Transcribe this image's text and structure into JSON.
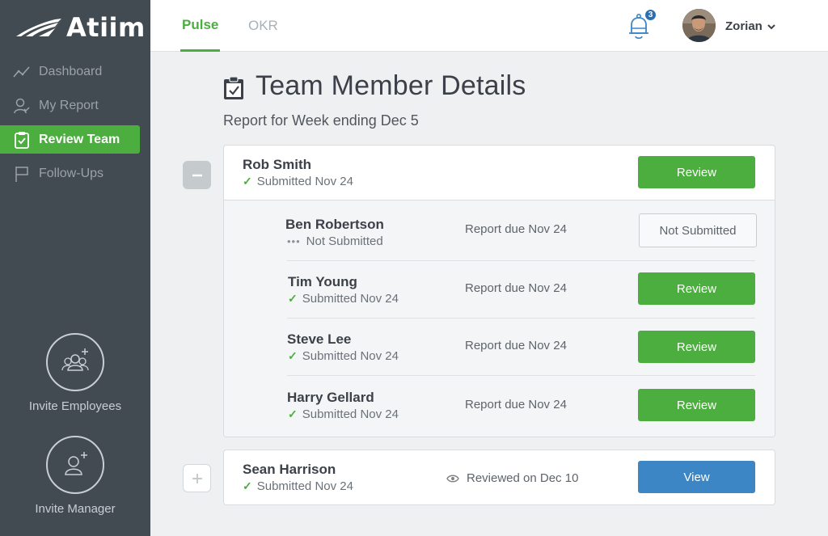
{
  "app": {
    "logo_text": "Atiim"
  },
  "sidebar": {
    "items": [
      {
        "label": "Dashboard"
      },
      {
        "label": "My Report"
      },
      {
        "label": "Review Team"
      },
      {
        "label": "Follow-Ups"
      }
    ],
    "invite_employees": "Invite Employees",
    "invite_manager": "Invite Manager"
  },
  "topbar": {
    "tabs": [
      {
        "label": "Pulse"
      },
      {
        "label": "OKR"
      }
    ],
    "notification_count": "3",
    "user_name": "Zorian"
  },
  "page": {
    "title": "Team Member Details",
    "subtitle": "Report for Week ending Dec 5"
  },
  "manager": {
    "name": "Rob Smith",
    "status": "Submitted Nov 24",
    "button": "Review"
  },
  "reports": [
    {
      "name": "Ben Robertson",
      "status": "Not Submitted",
      "due": "Report due Nov 24",
      "button": "Not Submitted"
    },
    {
      "name": "Tim Young",
      "status": "Submitted Nov 24",
      "due": "Report due Nov 24",
      "button": "Review"
    },
    {
      "name": "Steve Lee",
      "status": "Submitted Nov 24",
      "due": "Report due Nov 24",
      "button": "Review"
    },
    {
      "name": "Harry Gellard",
      "status": "Submitted Nov 24",
      "due": "Report due Nov 24",
      "button": "Review"
    }
  ],
  "second_manager": {
    "name": "Sean Harrison",
    "status": "Submitted Nov 24",
    "reviewed": "Reviewed on Dec 10",
    "button": "View"
  },
  "colors": {
    "accent_green": "#4bae3e",
    "accent_blue": "#3d86c6",
    "sidebar_bg": "#424b52"
  }
}
